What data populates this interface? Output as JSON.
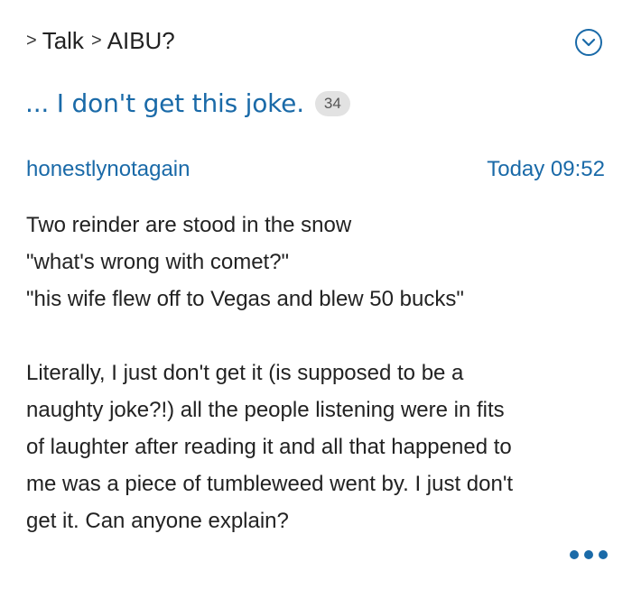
{
  "breadcrumb": {
    "separator": ">",
    "items": [
      "Talk",
      "AIBU?"
    ]
  },
  "thread": {
    "title": "... I don't get this joke.",
    "reply_count": "34"
  },
  "post": {
    "author": "honestlynotagain",
    "timestamp": "Today 09:52",
    "joke_lines": [
      "Two reinder are stood in the snow",
      "\"what's wrong with comet?\"",
      "\"his wife flew off to Vegas and blew 50 bucks\""
    ],
    "body_lines": [
      "Literally, I just don't get it (is supposed to be a",
      "naughty joke?!) all the people listening were in fits",
      "of laughter after reading it and all that happened to",
      "me was a piece of tumbleweed went by. I just don't",
      "get it. Can anyone explain?"
    ]
  },
  "icons": {
    "expand": "chevron-down-circle-icon",
    "more": "more-options-icon"
  },
  "colors": {
    "link": "#1a6aa8",
    "text": "#222222",
    "badge_bg": "#e2e2e2"
  }
}
